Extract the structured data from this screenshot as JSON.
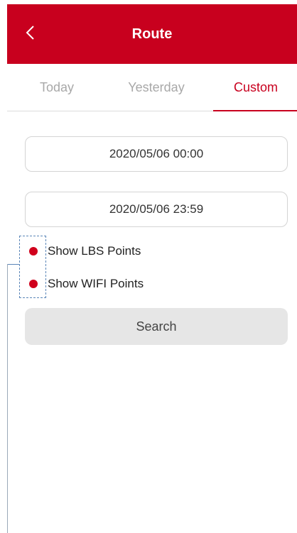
{
  "header": {
    "title": "Route",
    "back_icon": "chevron-left-icon",
    "background_color": "#c8001e"
  },
  "tabs": [
    {
      "label": "Today",
      "active": false
    },
    {
      "label": "Yesterday",
      "active": false
    },
    {
      "label": "Custom",
      "active": true
    }
  ],
  "range": {
    "start": "2020/05/06 00:00",
    "end": "2020/05/06 23:59"
  },
  "options": [
    {
      "label": "Show LBS Points",
      "selected": true
    },
    {
      "label": "Show WIFI Points",
      "selected": true
    }
  ],
  "search_button": {
    "label": "Search"
  },
  "colors": {
    "accent": "#c8001e",
    "inactive_tab": "#a8a8a8",
    "annotation": "#5b86b8"
  }
}
